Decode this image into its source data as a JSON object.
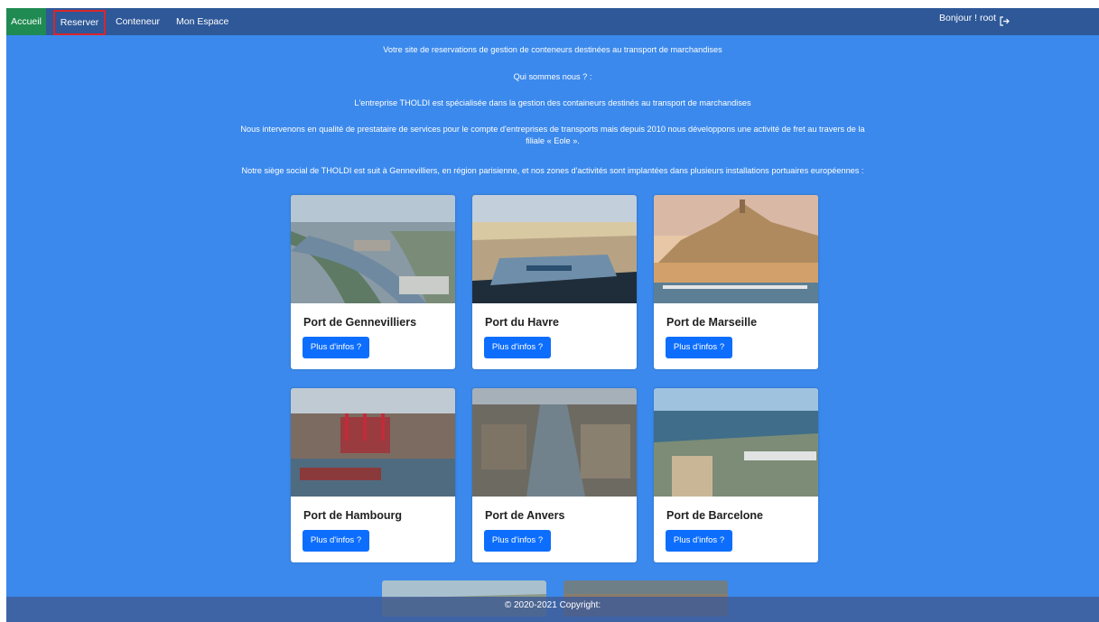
{
  "nav": {
    "items": [
      "Accueil",
      "Reserver",
      "Conteneur",
      "Mon Espace"
    ],
    "greeting": "Bonjour ! root"
  },
  "intro": {
    "line1": "Votre site de reservations de gestion de conteneurs destinées au transport de marchandises",
    "line2": "Qui sommes nous ? :",
    "line3": "L'entreprise THOLDI est spécialisée dans la gestion des containeurs destinés au transport de marchandises",
    "line4": "Nous intervenons en qualité de prestataire de services pour le compte d'entreprises de transports mais depuis 2010 nous développons une activité de fret au travers de la filiale « Eole ».",
    "line5": "Notre siège social de THOLDI est suit à Gennevilliers, en région parisienne, et nos zones d'activités sont implantées dans plusieurs installations portuaires européennes :"
  },
  "cards": [
    {
      "title": "Port de Gennevilliers",
      "button": "Plus d'infos ?"
    },
    {
      "title": "Port du Havre",
      "button": "Plus d'infos ?"
    },
    {
      "title": "Port de Marseille",
      "button": "Plus d'infos ?"
    },
    {
      "title": "Port de Hambourg",
      "button": "Plus d'infos ?"
    },
    {
      "title": "Port de Anvers",
      "button": "Plus d'infos ?"
    },
    {
      "title": "Port de Barcelone",
      "button": "Plus d'infos ?"
    }
  ],
  "footer": {
    "text": "© 2020-2021 Copyright:"
  },
  "icons": {
    "logout": "logout-icon"
  }
}
